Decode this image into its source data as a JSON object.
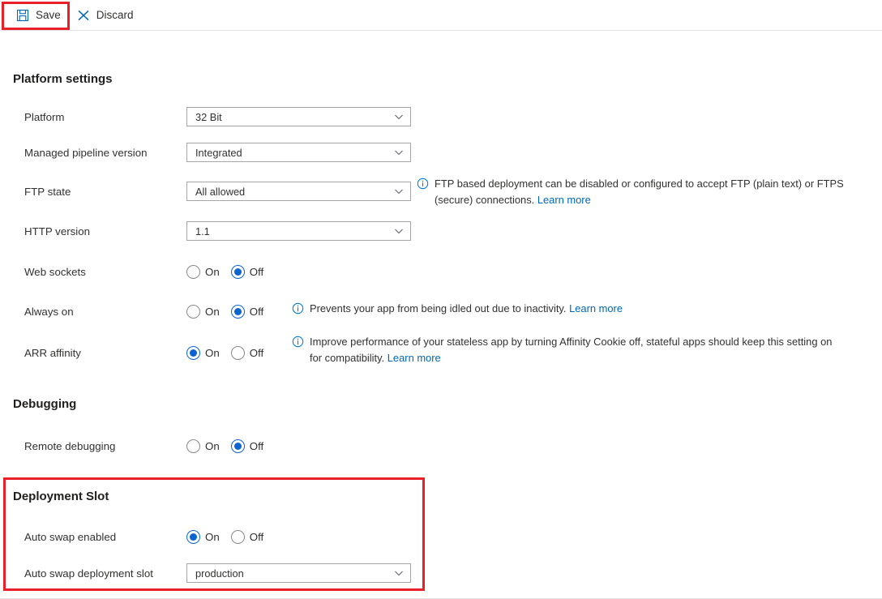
{
  "toolbar": {
    "save_label": "Save",
    "save_icon": "save-floppy-icon",
    "discard_label": "Discard",
    "discard_icon": "close-x-icon",
    "accent_color": "#0067b8",
    "highlight_color": "#e8202a"
  },
  "sections": {
    "platform": {
      "title": "Platform settings",
      "rows": {
        "platform": {
          "label": "Platform",
          "value": "32 Bit"
        },
        "pipeline": {
          "label": "Managed pipeline version",
          "value": "Integrated"
        },
        "ftp_state": {
          "label": "FTP state",
          "value": "All allowed",
          "info": "FTP based deployment can be disabled or configured to accept FTP (plain text) or FTPS (secure) connections. ",
          "info_link": "Learn more"
        },
        "http_version": {
          "label": "HTTP version",
          "value": "1.1"
        },
        "web_sockets": {
          "label": "Web sockets",
          "on_label": "On",
          "off_label": "Off",
          "selected": "Off"
        },
        "always_on": {
          "label": "Always on",
          "on_label": "On",
          "off_label": "Off",
          "selected": "Off",
          "info": "Prevents your app from being idled out due to inactivity. ",
          "info_link": "Learn more"
        },
        "arr_affinity": {
          "label": "ARR affinity",
          "on_label": "On",
          "off_label": "Off",
          "selected": "On",
          "info": "Improve performance of your stateless app by turning Affinity Cookie off, stateful apps should keep this setting on for compatibility. ",
          "info_link": "Learn more"
        }
      }
    },
    "debugging": {
      "title": "Debugging",
      "rows": {
        "remote_debugging": {
          "label": "Remote debugging",
          "on_label": "On",
          "off_label": "Off",
          "selected": "Off"
        }
      }
    },
    "deployment_slot": {
      "title": "Deployment Slot",
      "rows": {
        "auto_swap_enabled": {
          "label": "Auto swap enabled",
          "on_label": "On",
          "off_label": "Off",
          "selected": "On"
        },
        "auto_swap_slot": {
          "label": "Auto swap deployment slot",
          "value": "production"
        }
      }
    }
  }
}
